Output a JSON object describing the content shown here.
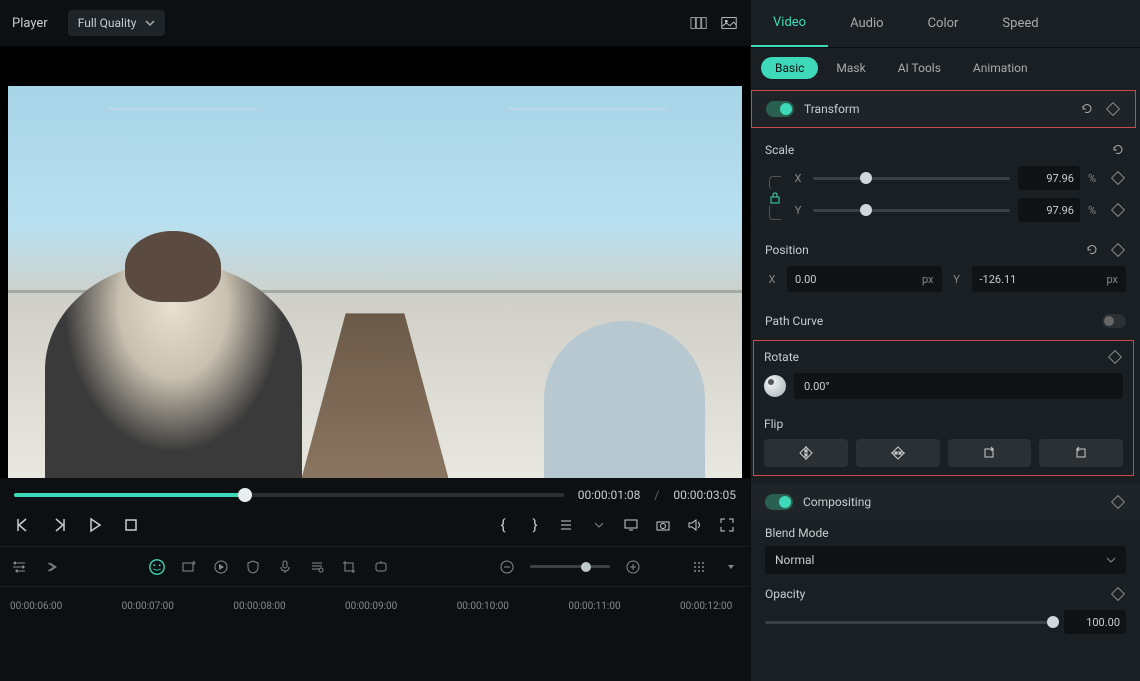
{
  "player": {
    "title": "Player",
    "quality": "Full Quality"
  },
  "transport": {
    "current": "00:00:01:08",
    "total": "00:00:03:05"
  },
  "ruler": [
    "00:00:06:00",
    "00:00:07:00",
    "00:00:08:00",
    "00:00:09:00",
    "00:00:10:00",
    "00:00:11:00",
    "00:00:12:00"
  ],
  "tabs": {
    "video": "Video",
    "audio": "Audio",
    "color": "Color",
    "speed": "Speed"
  },
  "subtabs": {
    "basic": "Basic",
    "mask": "Mask",
    "aitools": "AI Tools",
    "animation": "Animation"
  },
  "transform": {
    "label": "Transform",
    "scale": {
      "label": "Scale",
      "x_label": "X",
      "y_label": "Y",
      "x_value": "97.96",
      "y_value": "97.96",
      "unit": "%"
    },
    "position": {
      "label": "Position",
      "x_label": "X",
      "y_label": "Y",
      "x_value": "0.00",
      "y_value": "-126.11",
      "unit": "px"
    },
    "path_curve": "Path Curve",
    "rotate": {
      "label": "Rotate",
      "value": "0.00°"
    },
    "flip": {
      "label": "Flip"
    }
  },
  "compositing": {
    "label": "Compositing",
    "blend": {
      "label": "Blend Mode",
      "value": "Normal"
    },
    "opacity": {
      "label": "Opacity",
      "value": "100.00"
    }
  }
}
